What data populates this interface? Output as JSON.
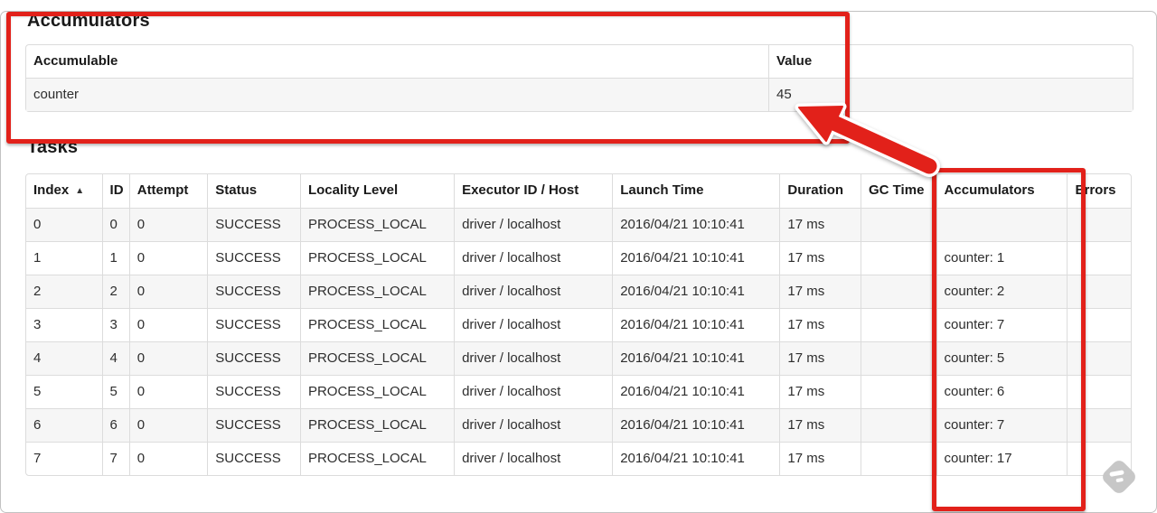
{
  "annotation_color": "#e2211a",
  "icons": {
    "sort_ascending": "▲",
    "watermark": "skitch-diamond"
  },
  "accumulators_section": {
    "title": "Accumulators",
    "table": {
      "headers": [
        "Accumulable",
        "Value"
      ],
      "rows": [
        [
          "counter",
          "45"
        ]
      ]
    }
  },
  "tasks_section": {
    "title": "Tasks",
    "table": {
      "headers": [
        "Index",
        "ID",
        "Attempt",
        "Status",
        "Locality Level",
        "Executor ID / Host",
        "Launch Time",
        "Duration",
        "GC Time",
        "Accumulators",
        "Errors"
      ],
      "sort_indicator": "▲",
      "rows": [
        [
          "0",
          "0",
          "0",
          "SUCCESS",
          "PROCESS_LOCAL",
          "driver / localhost",
          "2016/04/21 10:10:41",
          "17 ms",
          "",
          "",
          ""
        ],
        [
          "1",
          "1",
          "0",
          "SUCCESS",
          "PROCESS_LOCAL",
          "driver / localhost",
          "2016/04/21 10:10:41",
          "17 ms",
          "",
          "counter: 1",
          ""
        ],
        [
          "2",
          "2",
          "0",
          "SUCCESS",
          "PROCESS_LOCAL",
          "driver / localhost",
          "2016/04/21 10:10:41",
          "17 ms",
          "",
          "counter: 2",
          ""
        ],
        [
          "3",
          "3",
          "0",
          "SUCCESS",
          "PROCESS_LOCAL",
          "driver / localhost",
          "2016/04/21 10:10:41",
          "17 ms",
          "",
          "counter: 7",
          ""
        ],
        [
          "4",
          "4",
          "0",
          "SUCCESS",
          "PROCESS_LOCAL",
          "driver / localhost",
          "2016/04/21 10:10:41",
          "17 ms",
          "",
          "counter: 5",
          ""
        ],
        [
          "5",
          "5",
          "0",
          "SUCCESS",
          "PROCESS_LOCAL",
          "driver / localhost",
          "2016/04/21 10:10:41",
          "17 ms",
          "",
          "counter: 6",
          ""
        ],
        [
          "6",
          "6",
          "0",
          "SUCCESS",
          "PROCESS_LOCAL",
          "driver / localhost",
          "2016/04/21 10:10:41",
          "17 ms",
          "",
          "counter: 7",
          ""
        ],
        [
          "7",
          "7",
          "0",
          "SUCCESS",
          "PROCESS_LOCAL",
          "driver / localhost",
          "2016/04/21 10:10:41",
          "17 ms",
          "",
          "counter: 17",
          ""
        ]
      ]
    }
  }
}
